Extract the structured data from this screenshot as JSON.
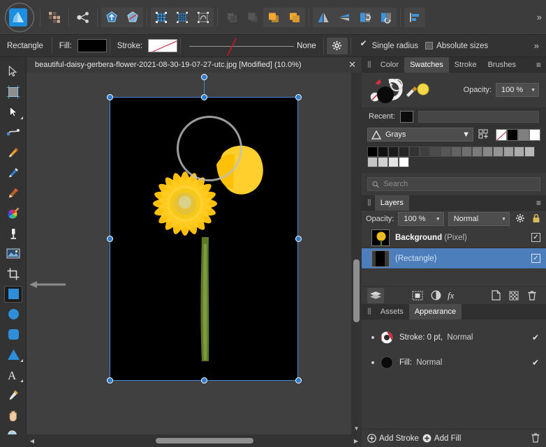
{
  "app": {
    "name": "Affinity Designer",
    "accent": "#1d8fe0",
    "selection_color": "#3d8bd6",
    "panel_bg": "#3a3a3a"
  },
  "toolbar": {
    "items": [
      {
        "name": "app-logo",
        "label": "Affinity"
      },
      {
        "name": "assistant-manager-icon",
        "label": "Assistant Manager"
      },
      {
        "name": "share-icon",
        "label": "Share"
      },
      {
        "name": "add-node-icon",
        "label": "Add node"
      },
      {
        "name": "break-curve-icon",
        "label": "Break curve"
      },
      {
        "name": "snapping-grid-icon",
        "label": "Snapping"
      },
      {
        "name": "grid-icon",
        "label": "Show grid"
      },
      {
        "name": "pixel-preview-icon",
        "label": "Pixel alignment"
      },
      {
        "name": "move-back-icon",
        "label": "Move back"
      },
      {
        "name": "move-forward-icon",
        "label": "Move forward"
      },
      {
        "name": "move-to-front-icon",
        "label": "Move to front"
      },
      {
        "name": "move-to-back-icon",
        "label": "Move to back"
      },
      {
        "name": "flip-horizontal-icon",
        "label": "Flip horizontal"
      },
      {
        "name": "flip-vertical-icon",
        "label": "Flip vertical"
      },
      {
        "name": "rotate-left-icon",
        "label": "Rotate left"
      },
      {
        "name": "rotate-right-icon",
        "label": "Rotate right"
      },
      {
        "name": "align-icon",
        "label": "Alignment"
      }
    ],
    "overflow_glyph": "»"
  },
  "context_bar": {
    "tool_name": "Rectangle",
    "fill_label": "Fill:",
    "fill_color": "#000000",
    "stroke_label": "Stroke:",
    "stroke_color": "none",
    "stroke_width_value": "None",
    "gear_icon": "gear-icon",
    "single_radius": {
      "label": "Single radius",
      "checked": true
    },
    "absolute_sizes": {
      "label": "Absolute sizes",
      "checked": false
    },
    "overflow_glyph": "»"
  },
  "document": {
    "tab_title": "beautiful-daisy-gerbera-flower-2021-08-30-19-07-27-utc.jpg [Modified] (10.0%)",
    "close_glyph": "✕",
    "zoom": "10.0%",
    "modified": true
  },
  "tools": [
    {
      "name": "move-tool",
      "label": "Move Tool",
      "active": false
    },
    {
      "name": "artboard-tool",
      "label": "Artboard Tool",
      "active": false
    },
    {
      "name": "node-tool",
      "label": "Node Tool",
      "active": false,
      "has_flyout": true
    },
    {
      "name": "corner-tool",
      "label": "Corner Tool",
      "active": false
    },
    {
      "name": "pen-tool",
      "label": "Pen Tool",
      "active": false
    },
    {
      "name": "pencil-tool",
      "label": "Pencil Tool",
      "active": false
    },
    {
      "name": "vector-brush-tool",
      "label": "Vector Brush Tool",
      "active": false
    },
    {
      "name": "fill-tool",
      "label": "Fill Tool",
      "active": false
    },
    {
      "name": "transparency-tool",
      "label": "Transparency Tool",
      "active": false
    },
    {
      "name": "place-image-tool",
      "label": "Place Image Tool",
      "active": false
    },
    {
      "name": "crop-tool",
      "label": "Crop Tool",
      "active": false
    },
    {
      "name": "rectangle-tool",
      "label": "Rectangle Tool",
      "active": true
    },
    {
      "name": "ellipse-tool",
      "label": "Ellipse Tool",
      "active": false
    },
    {
      "name": "rounded-rectangle-tool",
      "label": "Rounded Rectangle Tool",
      "active": false
    },
    {
      "name": "triangle-tool",
      "label": "Triangle Tool",
      "active": false,
      "has_flyout": true
    },
    {
      "name": "text-tool",
      "label": "Artistic Text Tool",
      "active": false,
      "has_flyout": true
    },
    {
      "name": "color-picker-tool",
      "label": "Colour Picker Tool",
      "active": false
    },
    {
      "name": "view-tool",
      "label": "View Tool",
      "active": false
    },
    {
      "name": "zoom-tool",
      "label": "Zoom Tool",
      "active": false
    }
  ],
  "canvas": {
    "background_color": "#404040",
    "artboard_color": "#000000",
    "image_description": "yellow gerbera daisy flower on black background",
    "selection_visible": true,
    "brush_cursor_visible": true
  },
  "swatches_panel": {
    "tabs": [
      {
        "label": "Color",
        "active": false
      },
      {
        "label": "Swatches",
        "active": true
      },
      {
        "label": "Stroke",
        "active": false
      },
      {
        "label": "Brushes",
        "active": false
      }
    ],
    "menu_glyph": "≡",
    "opacity_label": "Opacity:",
    "opacity_value": "100 %",
    "recent_label": "Recent:",
    "recent_colors": [
      "#0c0c0c"
    ],
    "palette_name": "Grays",
    "palette_icon": "affinity-palette-icon",
    "quick_swatches": [
      "none",
      "#000000",
      "#808080",
      "#ffffff"
    ],
    "grays_row1": [
      "#000000",
      "#101010",
      "#1c1c1c",
      "#262626",
      "#333333",
      "#3f3f3f",
      "#4b4b4b",
      "#575757",
      "#636363",
      "#6f6f6f",
      "#7b7b7b",
      "#888888",
      "#949494",
      "#a0a0a0",
      "#acacac",
      "#b8b8b8"
    ],
    "grays_row2": [
      "#c4c4c4",
      "#d0d0d0",
      "#e4e4e4",
      "#ffffff"
    ],
    "search_placeholder": "Search",
    "search_value": ""
  },
  "layers_panel": {
    "tabs": [
      {
        "label": "Layers",
        "active": true
      }
    ],
    "menu_glyph": "≡",
    "opacity_label": "Opacity:",
    "opacity_value": "100 %",
    "blend_mode": "Normal",
    "gear_icon": "gear-icon",
    "lock_icon": "lock-icon",
    "rows": [
      {
        "name": "Background",
        "type": "(Pixel)",
        "selected": false,
        "visible": true,
        "thumb": "flower"
      },
      {
        "name": "",
        "type": "(Rectangle)",
        "selected": true,
        "visible": true,
        "thumb": "black"
      }
    ],
    "bottom_icons": [
      "layers-stack-icon",
      "mask-icon",
      "adjustment-icon",
      "fx-icon",
      "new-layer-icon",
      "new-pixel-layer-icon",
      "delete-layer-icon"
    ]
  },
  "appearance_panel": {
    "tabs": [
      {
        "label": "Assets",
        "active": false
      },
      {
        "label": "Appearance",
        "active": true
      }
    ],
    "rows": [
      {
        "icon": "stroke-swatch-icon",
        "label": "Stroke:",
        "value": "0 pt,",
        "blend": "Normal",
        "checked": true
      },
      {
        "icon": "fill-swatch-icon",
        "label": "Fill:",
        "value": "",
        "blend": "Normal",
        "checked": true
      }
    ],
    "add_stroke_label": "Add Stroke",
    "add_fill_label": "Add Fill",
    "delete_icon": "trash-icon"
  },
  "annotation": {
    "arrow_direction": "left",
    "points_to": "rectangle-tool",
    "color": "#8c8c8c"
  }
}
